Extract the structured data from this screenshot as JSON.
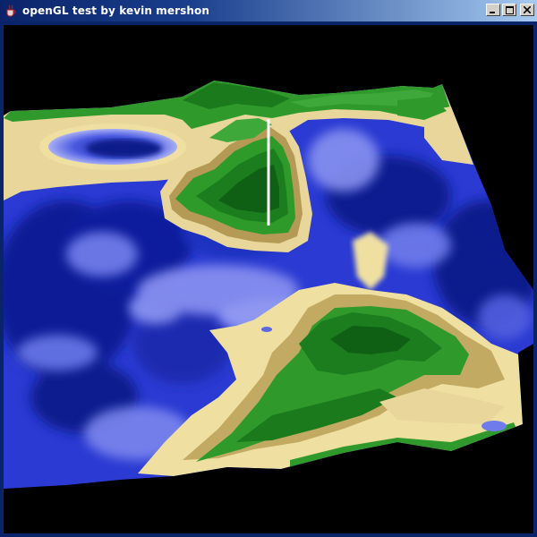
{
  "window": {
    "title": "openGL test by kevin mershon",
    "controls": {
      "minimize_icon": "minimize-icon",
      "maximize_icon": "maximize-icon",
      "close_icon": "close-icon"
    },
    "app_icon": "java-cup-icon"
  },
  "colors": {
    "titlebar_start": "#0a246a",
    "titlebar_end": "#a6caf0",
    "background": "#000000",
    "deep_water": "#0b1a8c",
    "water": "#2a3fd0",
    "shallow_water": "#8c94f0",
    "sand": "#efe0a2",
    "dark_sand": "#c0a861",
    "grass": "#2f9a2b",
    "forest": "#156a18",
    "marker": "#ffffff"
  }
}
